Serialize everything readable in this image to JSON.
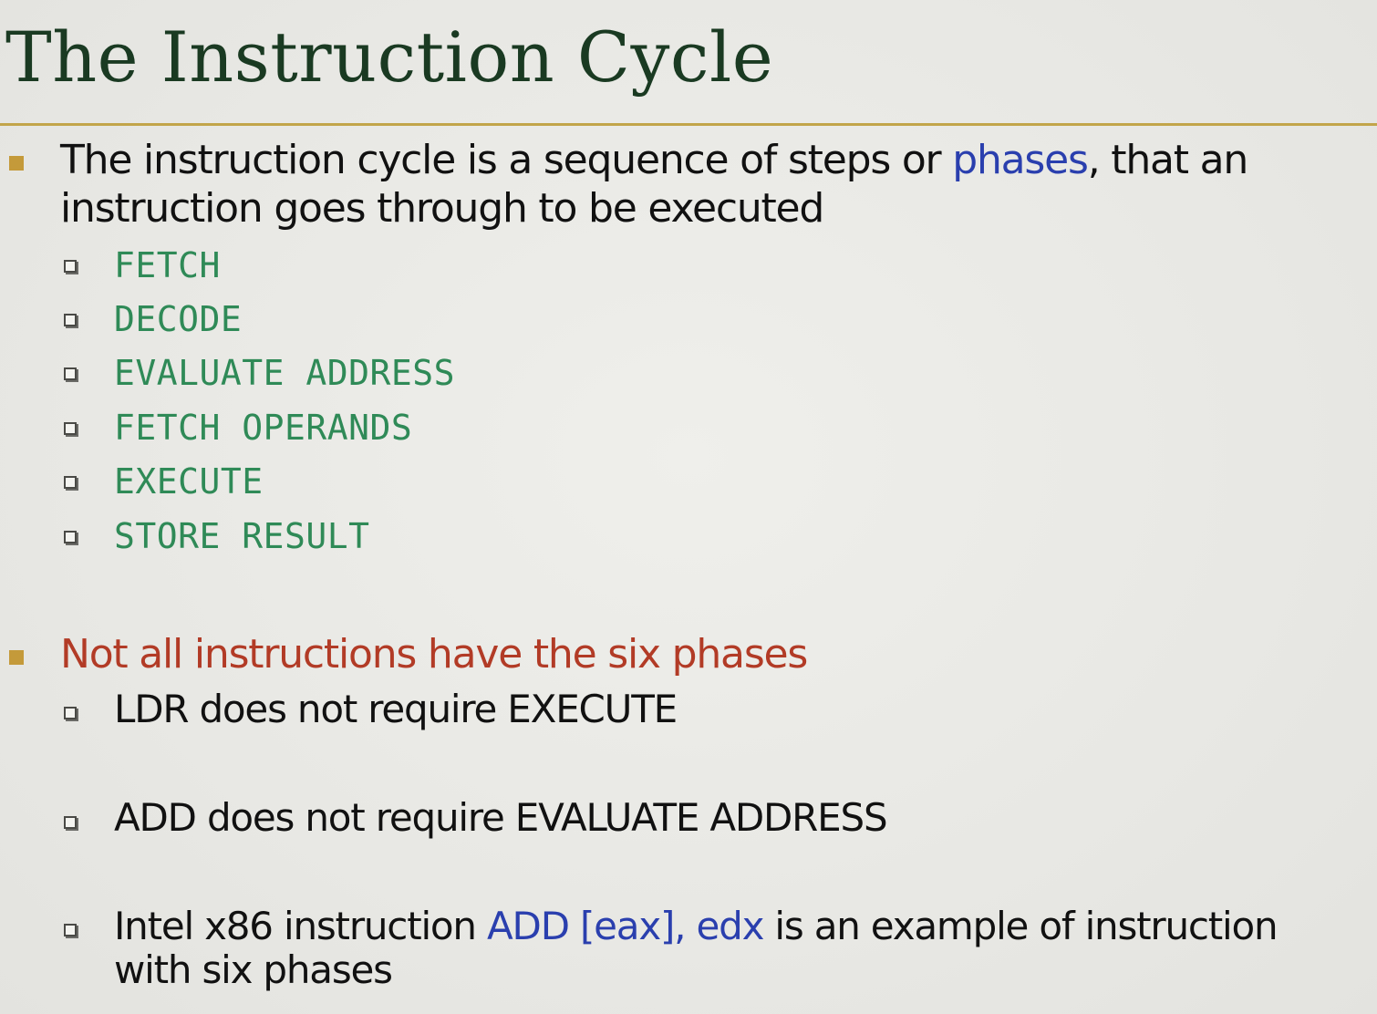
{
  "slide": {
    "title": "The Instruction Cycle",
    "bullet1": {
      "before": "The instruction cycle is a sequence of steps or ",
      "highlight": "phases",
      "after": ", that an",
      "line2": "instruction goes through to be executed"
    },
    "phases": [
      "FETCH",
      "DECODE",
      "EVALUATE ADDRESS",
      "FETCH OPERANDS",
      "EXECUTE",
      "STORE RESULT"
    ],
    "bullet2": {
      "text": "Not all instructions have the six phases"
    },
    "examples": {
      "ldr": "LDR does not require EXECUTE",
      "add": "ADD does not require EVALUATE ADDRESS",
      "intel_before": "Intel x86 instruction ",
      "intel_highlight": "ADD [eax], edx",
      "intel_after": " is an example of instruction",
      "intel_line2": "with six phases"
    }
  },
  "colors": {
    "title": "#1a3a22",
    "rule": "#c2a54a",
    "bullet": "#c49a3a",
    "phase_text": "#2f8a57",
    "highlight_blue": "#2a3fae",
    "highlight_red": "#b23b26"
  }
}
